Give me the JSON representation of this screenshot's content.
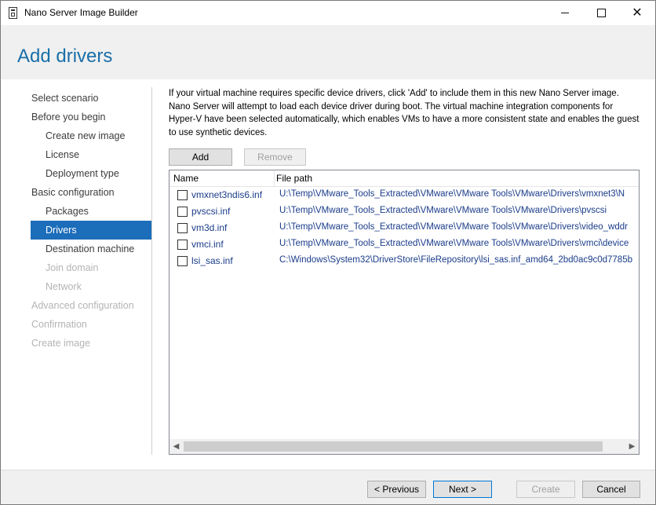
{
  "window": {
    "title": "Nano Server Image Builder",
    "icon": "app-icon"
  },
  "header": {
    "title": "Add drivers"
  },
  "nav": {
    "items": [
      {
        "label": "Select scenario",
        "level": 0,
        "state": "normal"
      },
      {
        "label": "Before you begin",
        "level": 0,
        "state": "normal"
      },
      {
        "label": "Create new image",
        "level": 1,
        "state": "normal"
      },
      {
        "label": "License",
        "level": 1,
        "state": "normal"
      },
      {
        "label": "Deployment type",
        "level": 1,
        "state": "normal"
      },
      {
        "label": "Basic configuration",
        "level": 0,
        "state": "normal"
      },
      {
        "label": "Packages",
        "level": 1,
        "state": "normal"
      },
      {
        "label": "Drivers",
        "level": 1,
        "state": "selected"
      },
      {
        "label": "Destination machine",
        "level": 1,
        "state": "normal"
      },
      {
        "label": "Join domain",
        "level": 1,
        "state": "disabled"
      },
      {
        "label": "Network",
        "level": 1,
        "state": "disabled"
      },
      {
        "label": "Advanced configuration",
        "level": 0,
        "state": "disabled"
      },
      {
        "label": "Confirmation",
        "level": 0,
        "state": "disabled"
      },
      {
        "label": "Create image",
        "level": 0,
        "state": "disabled"
      }
    ]
  },
  "main": {
    "description": "If your virtual machine requires specific device drivers, click 'Add' to include them in this new Nano Server image. Nano Server will attempt to load each device driver during boot. The virtual machine integration components for Hyper-V have been selected automatically, which enables VMs to have a more consistent state and enables the guest to use synthetic devices.",
    "add_label": "Add",
    "remove_label": "Remove",
    "table": {
      "columns": {
        "name": "Name",
        "path": "File path"
      },
      "rows": [
        {
          "name": "vmxnet3ndis6.inf",
          "path": "U:\\Temp\\VMware_Tools_Extracted\\VMware\\VMware Tools\\VMware\\Drivers\\vmxnet3\\N",
          "checked": false
        },
        {
          "name": "pvscsi.inf",
          "path": "U:\\Temp\\VMware_Tools_Extracted\\VMware\\VMware Tools\\VMware\\Drivers\\pvscsi",
          "checked": false
        },
        {
          "name": "vm3d.inf",
          "path": "U:\\Temp\\VMware_Tools_Extracted\\VMware\\VMware Tools\\VMware\\Drivers\\video_wddr",
          "checked": false
        },
        {
          "name": "vmci.inf",
          "path": "U:\\Temp\\VMware_Tools_Extracted\\VMware\\VMware Tools\\VMware\\Drivers\\vmci\\device",
          "checked": false
        },
        {
          "name": "lsi_sas.inf",
          "path": "C:\\Windows\\System32\\DriverStore\\FileRepository\\lsi_sas.inf_amd64_2bd0ac9c0d7785b",
          "checked": false
        }
      ]
    }
  },
  "footer": {
    "previous_label": "< Previous",
    "next_label": "Next >",
    "create_label": "Create",
    "cancel_label": "Cancel"
  },
  "colors": {
    "accent": "#1c6dba",
    "title_blue": "#1a6fa8",
    "link_text": "#1a3c8a"
  }
}
